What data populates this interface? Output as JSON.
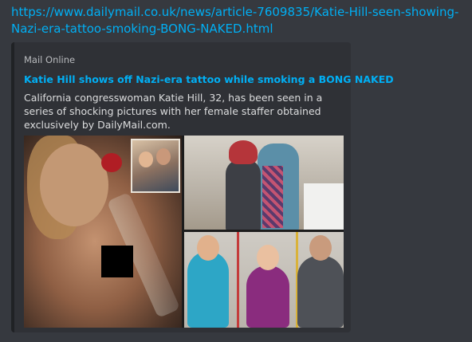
{
  "message": {
    "link_text": "https://www.dailymail.co.uk/news/article-7609835/Katie-Hill-seen-showing-Nazi-era-tattoo-smoking-BONG-NAKED.html"
  },
  "embed": {
    "provider": "Mail Online",
    "title": "Katie Hill shows off Nazi-era tattoo while smoking a BONG NAKED",
    "description": "California congresswoman Katie Hill, 32, has been seen in a series of shocking pictures with her female staffer obtained exclusively by DailyMail.com.",
    "accent_color": "#202225",
    "link_color": "#00aff4"
  },
  "colors": {
    "background": "#36393f",
    "embed_background": "#2f3136",
    "text": "#dcddde",
    "muted": "#b9bbbe"
  }
}
